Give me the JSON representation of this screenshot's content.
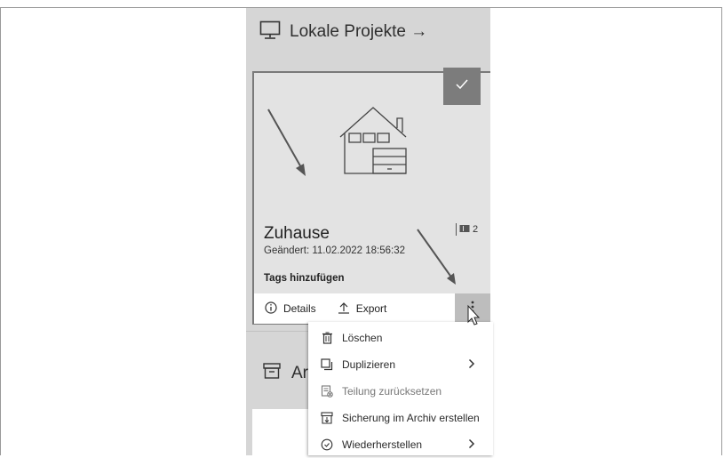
{
  "header": {
    "title": "Lokale Projekte →"
  },
  "project": {
    "name": "Zuhause",
    "modified": "Geändert: 11.02.2022 18:56:32",
    "tags_link": "Tags hinzufügen",
    "count": "2",
    "selected": true
  },
  "actions": {
    "details": "Details",
    "export": "Export"
  },
  "archive": {
    "title_partial": "Ar"
  },
  "context_menu": {
    "items": [
      {
        "label": "Löschen",
        "icon": "trash-icon",
        "disabled": false,
        "submenu": false
      },
      {
        "label": "Duplizieren",
        "icon": "duplicate-icon",
        "disabled": false,
        "submenu": true
      },
      {
        "label": "Teilung zurücksetzen",
        "icon": "reset-share-icon",
        "disabled": true,
        "submenu": false
      },
      {
        "label": "Sicherung im Archiv erstellen",
        "icon": "archive-backup-icon",
        "disabled": false,
        "submenu": false
      },
      {
        "label": "Wiederherstellen",
        "icon": "restore-icon",
        "disabled": false,
        "submenu": true
      }
    ]
  },
  "colors": {
    "panel_bg": "#d6d6d6",
    "card_bg": "#e3e3e3",
    "check_bg": "#7c7c7c",
    "menu_bg": "#ffffff"
  }
}
